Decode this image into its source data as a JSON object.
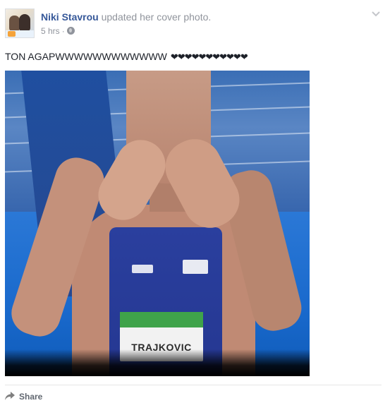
{
  "post": {
    "author": "Niki Stavrou",
    "action": "updated her cover photo.",
    "time": "5 hrs",
    "separator": "·",
    "privacy_icon": "globe-icon",
    "text": "TON AGAPWWWWWWWWWWWW",
    "hearts": "❤❤❤❤❤❤❤❤❤❤❤",
    "menu_icon": "chevron-down-icon"
  },
  "photo": {
    "bib_name": "TRAJKOVIC"
  },
  "actions": {
    "share_label": "Share",
    "share_icon": "share-arrow-icon"
  },
  "colors": {
    "author": "#365899",
    "meta": "#90949c",
    "text": "#1d2129"
  }
}
